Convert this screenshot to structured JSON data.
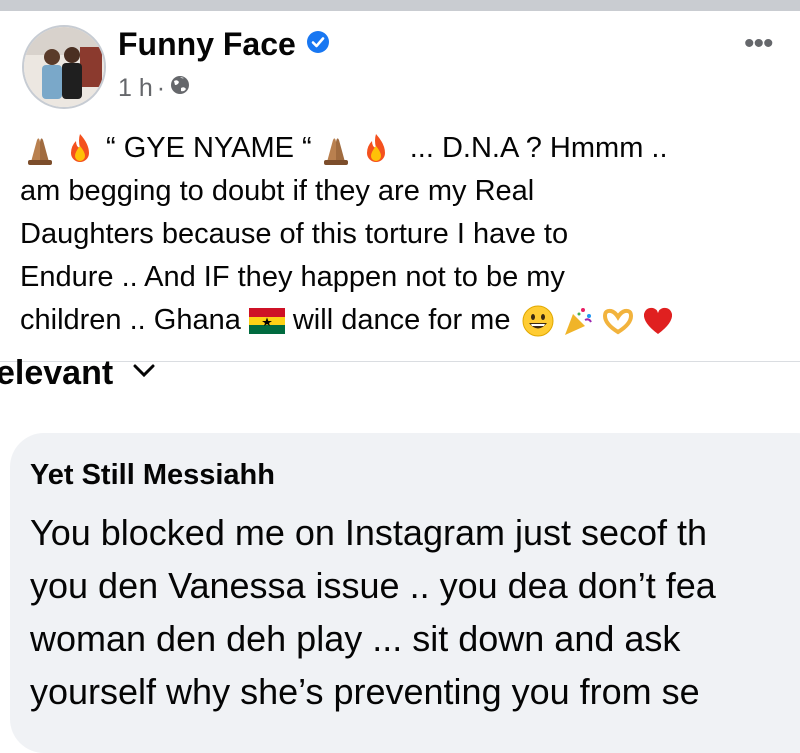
{
  "post": {
    "author": "Funny Face",
    "time": "1 h",
    "separator": "·",
    "lines": [
      {
        "before": "",
        "quote": "“ GYE NYAME “",
        "after": "... D.N.A ? Hmmm .."
      },
      "am begging to doubt if they are my Real",
      "Daughters because of this torture I have to",
      "Endure .. And IF they happen not to be my",
      {
        "a": "children .. Ghana",
        "b": "will dance for me"
      }
    ]
  },
  "filter": {
    "label": "elevant"
  },
  "comment": {
    "author": "Yet Still Messiahh",
    "lines": [
      "You blocked me on Instagram just secof th",
      "you den Vanessa issue .. you dea don’t fea",
      "woman den deh play ... sit down and ask",
      "yourself why she’s preventing you from se"
    ]
  },
  "colors": {
    "verified": "#1877f2",
    "secondary_text": "#65676b",
    "bubble": "#f0f2f5"
  },
  "icons": [
    "verified-badge-icon",
    "globe-icon",
    "more-options-icon",
    "chevron-down-icon",
    "folded-hands-emoji",
    "fire-emoji",
    "ghana-flag-emoji",
    "grinning-face-emoji",
    "party-popper-emoji",
    "heart-hands-emoji",
    "red-heart-emoji"
  ]
}
